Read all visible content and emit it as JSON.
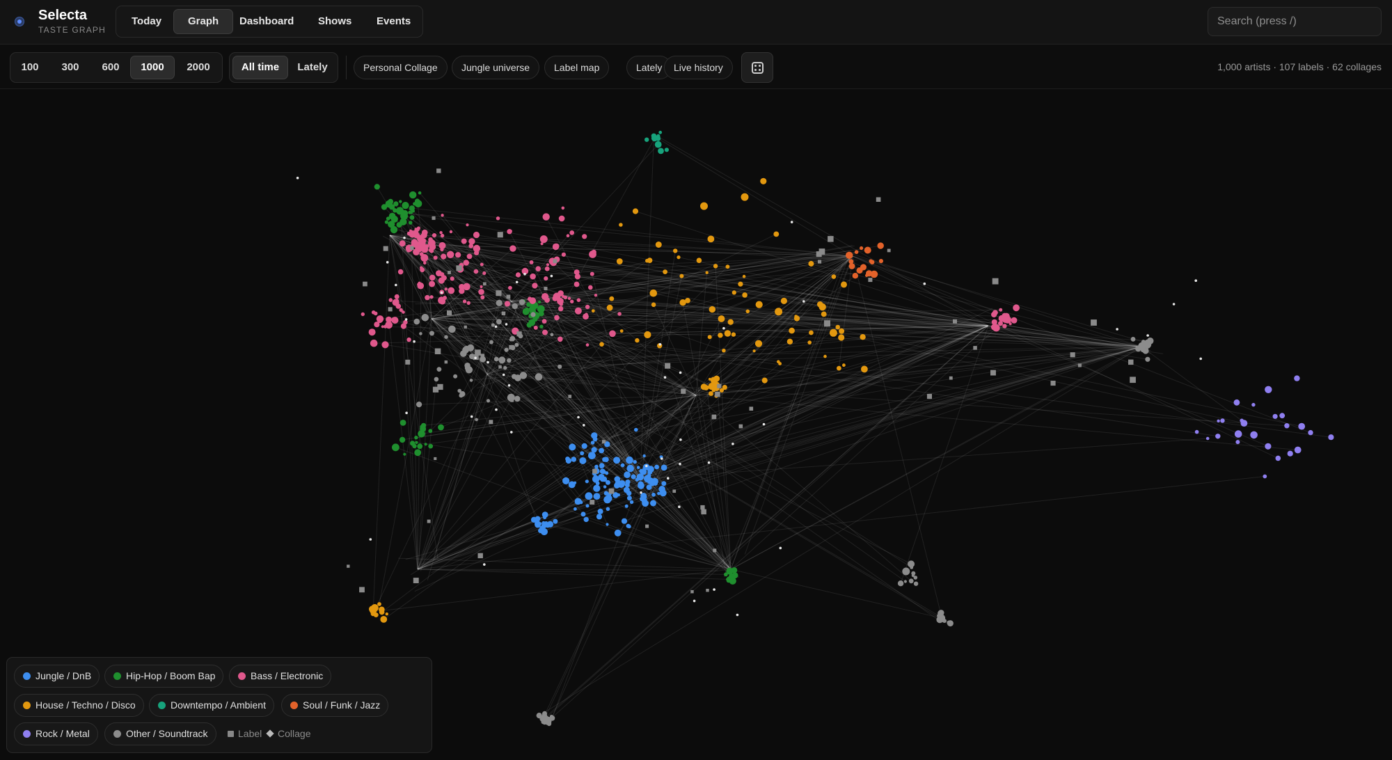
{
  "app": {
    "name": "Selecta",
    "subtitle": "TASTE GRAPH"
  },
  "nav": {
    "items": [
      {
        "label": "Today",
        "active": false
      },
      {
        "label": "Graph",
        "active": true
      },
      {
        "label": "Dashboard",
        "active": false
      },
      {
        "label": "Shows",
        "active": false
      },
      {
        "label": "Events",
        "active": false
      }
    ]
  },
  "search": {
    "placeholder": "Search (press /)",
    "value": ""
  },
  "toolbar": {
    "counts": {
      "options": [
        "100",
        "300",
        "600",
        "1000",
        "2000"
      ],
      "selected": "1000"
    },
    "range": {
      "options": [
        "All time",
        "Lately"
      ],
      "selected": "All time"
    },
    "presets": [
      "Personal Collage",
      "Jungle universe",
      "Label map",
      "Lately",
      "Live history"
    ],
    "random_icon": "dice-icon",
    "stats": "1,000 artists · 107 labels · 62 collages"
  },
  "legend": {
    "genres": [
      {
        "label": "Jungle / DnB",
        "color": "#3d8ef0"
      },
      {
        "label": "Hip-Hop / Boom Bap",
        "color": "#1f8f2e"
      },
      {
        "label": "Bass / Electronic",
        "color": "#e0588c"
      },
      {
        "label": "House / Techno / Disco",
        "color": "#e3980f"
      },
      {
        "label": "Downtempo / Ambient",
        "color": "#17a37c"
      },
      {
        "label": "Soul / Funk / Jazz",
        "color": "#e3622a"
      },
      {
        "label": "Rock / Metal",
        "color": "#8f7ff0"
      },
      {
        "label": "Other / Soundtrack",
        "color": "#8c8c8c"
      }
    ],
    "label_key": "Label",
    "collage_key": "Collage"
  }
}
